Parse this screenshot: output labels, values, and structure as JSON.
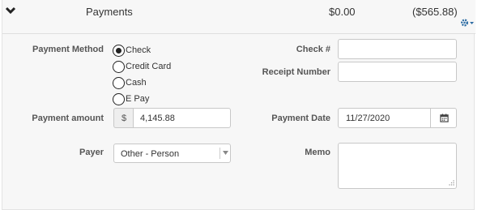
{
  "header": {
    "title": "Payments",
    "amount": "$0.00",
    "balance": "($565.88)"
  },
  "form": {
    "payment_method_label": "Payment Method",
    "payment_methods": [
      {
        "label": "Check",
        "selected": true
      },
      {
        "label": "Credit Card",
        "selected": false
      },
      {
        "label": "Cash",
        "selected": false
      },
      {
        "label": "E Pay",
        "selected": false
      }
    ],
    "check_number_label": "Check #",
    "check_number_value": "",
    "receipt_number_label": "Receipt Number",
    "receipt_number_value": "",
    "payment_amount_label": "Payment amount",
    "currency_symbol": "$",
    "payment_amount_value": "4,145.88",
    "payment_date_label": "Payment Date",
    "payment_date_value": "11/27/2020",
    "payer_label": "Payer",
    "payer_value": "Other - Person",
    "memo_label": "Memo",
    "memo_value": ""
  },
  "icons": {
    "collapse": "chevron-down-icon",
    "settings": "gear-icon",
    "calendar": "calendar-icon",
    "dropdown": "caret-down-icon",
    "resize": "resize-grip-icon"
  },
  "colors": {
    "panel_bg": "#f7f7f7",
    "accent_gear": "#2e6da4",
    "border": "#c8c8c8"
  }
}
